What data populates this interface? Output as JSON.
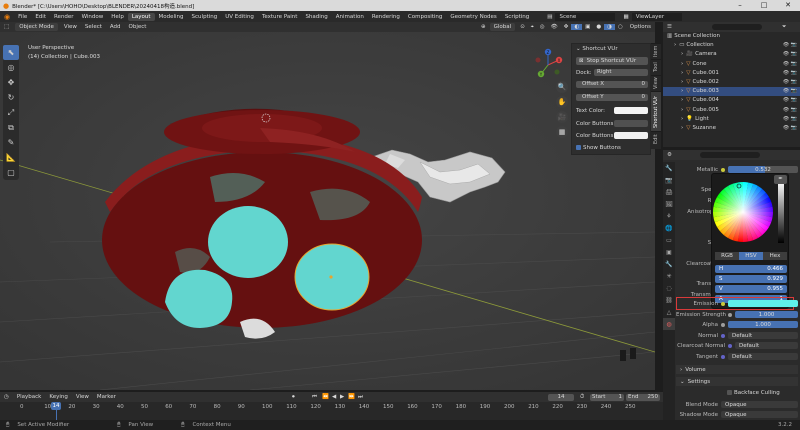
{
  "window": {
    "title": "Blender* [C:\\Users\\HOHO\\Desktop\\BLENDER\\20240418构造.blend]",
    "minimize": "–",
    "maximize": "□",
    "close": "✕"
  },
  "menubar": {
    "menus": [
      "File",
      "Edit",
      "Render",
      "Window",
      "Help"
    ],
    "workspaces": [
      "Layout",
      "Modeling",
      "Sculpting",
      "UV Editing",
      "Texture Paint",
      "Shading",
      "Animation",
      "Rendering",
      "Compositing",
      "Geometry Nodes",
      "Scripting"
    ],
    "active_workspace": "Layout",
    "scene": "Scene",
    "view_layer": "ViewLayer"
  },
  "viewport_header": {
    "mode": "Object Mode",
    "menus": [
      "View",
      "Select",
      "Add",
      "Object"
    ],
    "orientation": "Global",
    "options": "Options"
  },
  "viewport": {
    "view_name": "User Perspective",
    "collection_info": "(14) Collection | Cube.003"
  },
  "gizmo": {
    "x": "X",
    "y": "Y",
    "z": "Z"
  },
  "shortcut_panel": {
    "title": "Shortcut VUr",
    "stop_button": "Stop Shortcut VUr",
    "dock_label": "Dock:",
    "dock_value": "Right",
    "offset_x_label": "Offset X",
    "offset_x_value": "0",
    "offset_y_label": "Offset Y",
    "offset_y_value": "0",
    "text_color_label": "Text Color:",
    "color_buttons_label": "Color Buttons:",
    "color_buttons_a_label": "Color Buttons a...",
    "show_buttons_label": "Show Buttons"
  },
  "sidebar_tabs": [
    "Item",
    "Tool",
    "View",
    "Shortcut VUr",
    "Edit"
  ],
  "outliner": {
    "header": "Scene Collection",
    "items": [
      {
        "name": "Collection",
        "indent": 1,
        "selected": false
      },
      {
        "name": "Camera",
        "indent": 2,
        "selected": false
      },
      {
        "name": "Cone",
        "indent": 2,
        "selected": false
      },
      {
        "name": "Cube.001",
        "indent": 2,
        "selected": false
      },
      {
        "name": "Cube.002",
        "indent": 2,
        "selected": false
      },
      {
        "name": "Cube.003",
        "indent": 2,
        "selected": true
      },
      {
        "name": "Cube.004",
        "indent": 2,
        "selected": false
      },
      {
        "name": "Cube.005",
        "indent": 2,
        "selected": false
      },
      {
        "name": "Light",
        "indent": 2,
        "selected": false
      },
      {
        "name": "Suzanne",
        "indent": 2,
        "selected": false
      }
    ]
  },
  "properties": {
    "metallic_label": "Metallic",
    "metallic_value": "0.532",
    "specular_label": "Specu",
    "roughness_label": "Rou",
    "anisotropic_label": "Anisotropic",
    "sheen_label": "She",
    "clearcoat_label": "Clearcoat R",
    "transmission_label": "Transmi",
    "transmission_r_label": "Transmiss",
    "emission_label": "Emission",
    "emission_color": "#5ff0ea",
    "emission_strength_label": "Emission Strength",
    "emission_strength_value": "1.000",
    "alpha_label": "Alpha",
    "alpha_value": "1.000",
    "normal_label": "Normal",
    "normal_value": "Default",
    "clearcoat_normal_label": "Clearcoat Normal",
    "clearcoat_normal_value": "Default",
    "tangent_label": "Tangent",
    "tangent_value": "Default",
    "volume_section": "Volume",
    "settings_section": "Settings",
    "backface_label": "Backface Culling",
    "blend_mode_label": "Blend Mode",
    "blend_mode_value": "Opaque",
    "shadow_mode_label": "Shadow Mode",
    "shadow_mode_value": "Opaque"
  },
  "color_picker": {
    "tabs": [
      "RGB",
      "HSV",
      "Hex"
    ],
    "active_tab": "HSV",
    "h_label": "H",
    "h_value": "0.466",
    "s_label": "S",
    "s_value": "0.929",
    "v_label": "V",
    "v_value": "0.955",
    "a_label": "A",
    "a_value": "1"
  },
  "timeline": {
    "menus": [
      "Playback",
      "Keying",
      "View",
      "Marker"
    ],
    "current_frame": "14",
    "start_label": "Start",
    "start_value": "1",
    "end_label": "End",
    "end_value": "250",
    "ticks": [
      "0",
      "10",
      "20",
      "30",
      "40",
      "50",
      "60",
      "70",
      "80",
      "90",
      "100",
      "110",
      "120",
      "130",
      "140",
      "150",
      "160",
      "170",
      "180",
      "190",
      "200",
      "210",
      "220",
      "230",
      "240",
      "250"
    ]
  },
  "statusbar": {
    "set_active_modifier": "Set Active Modifier",
    "pan_view": "Pan View",
    "context_menu": "Context Menu",
    "version": "3.2.2"
  },
  "colors": {
    "accent": "#4772b3",
    "mesh_red": "#7a1616",
    "mesh_cyan": "#62d6cf",
    "highlight": "#d93a3a"
  }
}
